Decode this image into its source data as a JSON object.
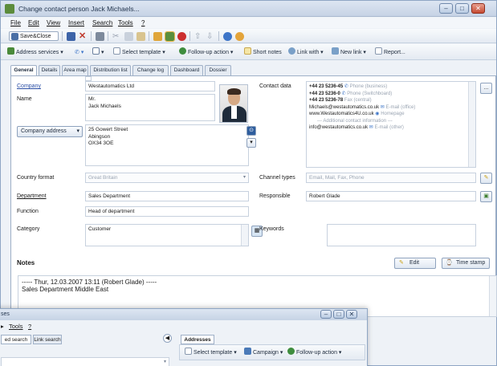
{
  "window": {
    "title": "Change contact person Jack Michaels...",
    "controls": [
      "–",
      "□",
      "✕"
    ]
  },
  "menu": [
    "File",
    "Edit",
    "View",
    "Insert",
    "Search",
    "Tools",
    "?"
  ],
  "toolbar1": {
    "save_close_label": "Save&Close"
  },
  "toolbar2": {
    "address_services": "Address services",
    "select_template": "Select template",
    "follow_up_action": "Follow-up action",
    "short_notes": "Short notes",
    "link_with": "Link with",
    "new_link": "New link",
    "report": "Report..."
  },
  "tabs": [
    "General",
    "Details",
    "Area map",
    "Distribution list",
    "Change log",
    "Dashboard",
    "Dossier"
  ],
  "form": {
    "company_label": "Company",
    "company_value": "Westautomatics Ltd",
    "name_label": "Name",
    "name_line1": "Mr.",
    "name_line2": "Jack Michaels",
    "address_select": "Company address",
    "address_lines": [
      "25 Gowert Street",
      "Abingson",
      "OX34 3OE"
    ],
    "country_format_label": "Country format",
    "country_format_value": "Great Britain",
    "department_label": "Department",
    "department_value": "Sales Department",
    "function_label": "Function",
    "function_value": "Head of department",
    "category_label": "Category",
    "category_value": "Customer",
    "contact_data_label": "Contact data",
    "contacts": [
      {
        "value": "+44 23 5236-45",
        "type": "Phone (business)"
      },
      {
        "value": "+44 23 5236-0",
        "type": "Phone (Switchboard)"
      },
      {
        "value": "+44 23 5236-78",
        "type": "Fax (central)"
      },
      {
        "value": "Michaels@westautomatics.co.uk",
        "type": "E-mail (office)"
      },
      {
        "value": "www.Westautomatics4U.co.uk",
        "type": "Homepage"
      }
    ],
    "additional_contact_header": "Additional contact information",
    "additional_contact": {
      "value": "info@westautomatics.co.uk",
      "type": "E-mail (other)"
    },
    "channel_types_label": "Channel types",
    "channel_types_value": "Email, Mail, Fax, Phone",
    "responsible_label": "Responsible",
    "responsible_value": "Robert Glade",
    "keywords_label": "Keywords",
    "more_button": "..."
  },
  "notes": {
    "label": "Notes",
    "edit_button": "Edit",
    "timestamp_button": "Time stamp",
    "line1": "----- Thur, 12.03.2007 13:11 (Robert Glade) -----",
    "line2": "Sales Department Middle East"
  },
  "subwindow": {
    "title_partial": "ses",
    "menu_tools": "Tools",
    "menu_help": "?",
    "tab_search": "ed search",
    "tab_link_search": "Link search",
    "addresses_tab": "Addresses",
    "select_template": "Select template",
    "campaign": "Campaign",
    "follow_up_action": "Follow-up action"
  },
  "colors": {
    "link": "#2b4fa6",
    "title_bar": "#c6d3e5",
    "close_button": "#c64a32"
  }
}
